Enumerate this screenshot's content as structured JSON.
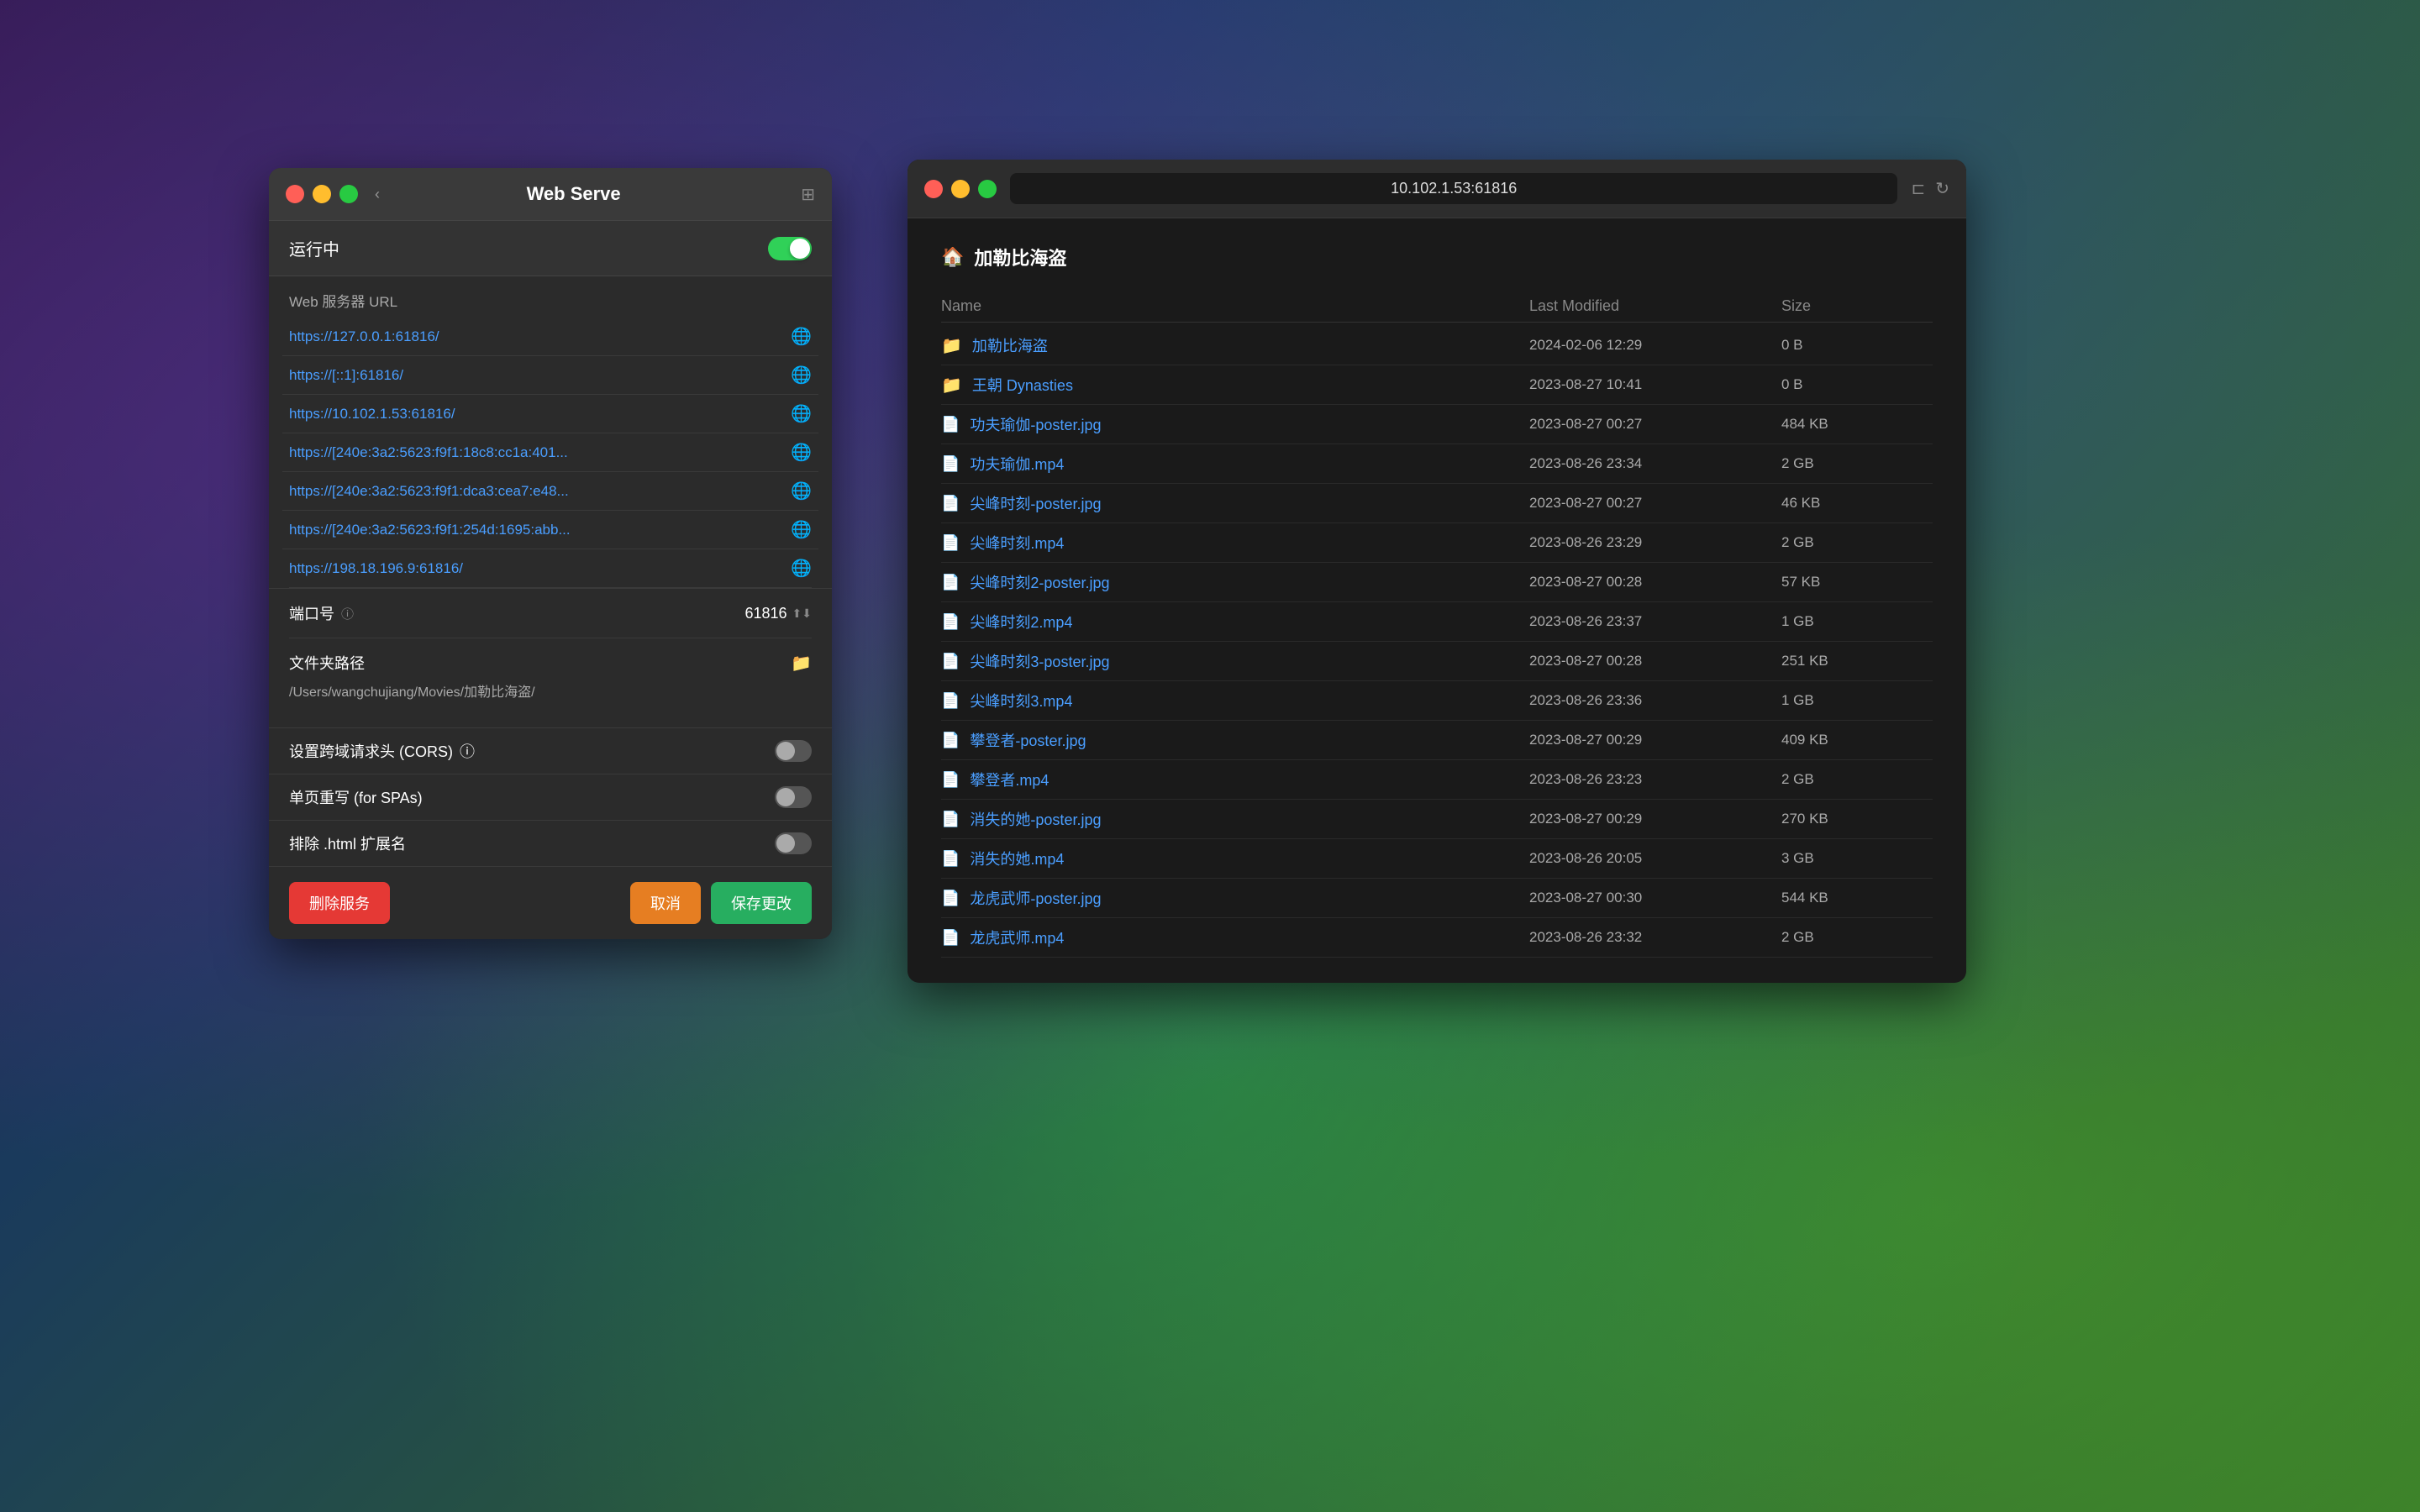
{
  "webServeWindow": {
    "title": "Web Serve",
    "statusLabel": "运行中",
    "toggleOn": true,
    "urlSectionLabel": "Web 服务器 URL",
    "urls": [
      {
        "text": "https://127.0.0.1:61816/",
        "id": "url-1"
      },
      {
        "text": "https://[::1]:61816/",
        "id": "url-2"
      },
      {
        "text": "https://10.102.1.53:61816/",
        "id": "url-3"
      },
      {
        "text": "https://[240e:3a2:5623:f9f1:18c8:cc1a:401...",
        "id": "url-4"
      },
      {
        "text": "https://[240e:3a2:5623:f9f1:dca3:cea7:e48...",
        "id": "url-5"
      },
      {
        "text": "https://[240e:3a2:5623:f9f1:254d:1695:abb...",
        "id": "url-6"
      },
      {
        "text": "https://198.18.196.9:61816/",
        "id": "url-7"
      }
    ],
    "portLabel": "端口号",
    "portHelpIcon": "?",
    "portValue": "61816",
    "folderLabel": "文件夹路径",
    "folderPath": "/Users/wangchujiang/Movies/加勒比海盗/",
    "corsLabel": "设置跨域请求头 (CORS)",
    "corsHelpIcon": "?",
    "corsEnabled": false,
    "spaLabel": "单页重写 (for SPAs)",
    "spaEnabled": false,
    "excludeHtmlLabel": "排除 .html 扩展名",
    "excludeHtmlEnabled": false,
    "deleteButton": "删除服务",
    "cancelButton": "取消",
    "saveButton": "保存更改"
  },
  "browserWindow": {
    "addressBar": "10.102.1.53:61816",
    "breadcrumb": "加勒比海盗",
    "homeIcon": "🏠",
    "table": {
      "headers": [
        "Name",
        "Last Modified",
        "Size"
      ],
      "rows": [
        {
          "icon": "folder",
          "name": "加勒比海盗",
          "date": "2024-02-06 12:29",
          "size": "0 B"
        },
        {
          "icon": "folder",
          "name": "王朝 Dynasties",
          "date": "2023-08-27 10:41",
          "size": "0 B"
        },
        {
          "icon": "file",
          "name": "功夫瑜伽-poster.jpg",
          "date": "2023-08-27 00:27",
          "size": "484 KB"
        },
        {
          "icon": "file",
          "name": "功夫瑜伽.mp4",
          "date": "2023-08-26 23:34",
          "size": "2 GB"
        },
        {
          "icon": "file",
          "name": "尖峰时刻-poster.jpg",
          "date": "2023-08-27 00:27",
          "size": "46 KB"
        },
        {
          "icon": "file",
          "name": "尖峰时刻.mp4",
          "date": "2023-08-26 23:29",
          "size": "2 GB"
        },
        {
          "icon": "file",
          "name": "尖峰时刻2-poster.jpg",
          "date": "2023-08-27 00:28",
          "size": "57 KB"
        },
        {
          "icon": "file",
          "name": "尖峰时刻2.mp4",
          "date": "2023-08-26 23:37",
          "size": "1 GB"
        },
        {
          "icon": "file",
          "name": "尖峰时刻3-poster.jpg",
          "date": "2023-08-27 00:28",
          "size": "251 KB"
        },
        {
          "icon": "file",
          "name": "尖峰时刻3.mp4",
          "date": "2023-08-26 23:36",
          "size": "1 GB"
        },
        {
          "icon": "file",
          "name": "攀登者-poster.jpg",
          "date": "2023-08-27 00:29",
          "size": "409 KB"
        },
        {
          "icon": "file",
          "name": "攀登者.mp4",
          "date": "2023-08-26 23:23",
          "size": "2 GB"
        },
        {
          "icon": "file",
          "name": "消失的她-poster.jpg",
          "date": "2023-08-27 00:29",
          "size": "270 KB"
        },
        {
          "icon": "file",
          "name": "消失的她.mp4",
          "date": "2023-08-26 20:05",
          "size": "3 GB"
        },
        {
          "icon": "file",
          "name": "龙虎武师-poster.jpg",
          "date": "2023-08-27 00:30",
          "size": "544 KB"
        },
        {
          "icon": "file",
          "name": "龙虎武师.mp4",
          "date": "2023-08-26 23:32",
          "size": "2 GB"
        }
      ]
    }
  }
}
